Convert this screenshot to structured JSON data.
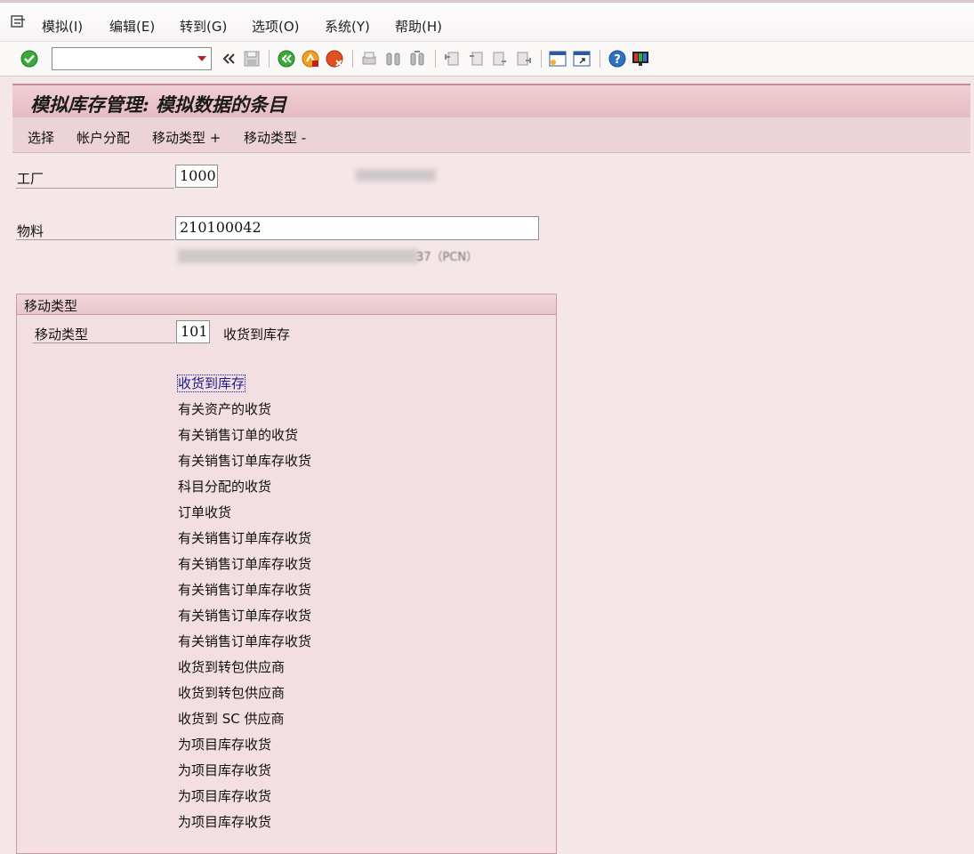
{
  "menubar": {
    "items": [
      "模拟(I)",
      "编辑(E)",
      "转到(G)",
      "选项(O)",
      "系统(Y)",
      "帮助(H)"
    ]
  },
  "toolbar": {
    "command_field_value": "",
    "icons": [
      "enter-icon",
      "back-nav-icon",
      "save-icon",
      "back-icon",
      "exit-icon",
      "cancel-icon",
      "print-icon",
      "find-icon",
      "find-next-icon",
      "first-page-icon",
      "prev-page-icon",
      "next-page-icon",
      "last-page-icon",
      "new-session-icon",
      "shortcut-icon",
      "help-icon",
      "customize-layout-icon"
    ]
  },
  "title": "模拟库存管理: 模拟数据的条目",
  "appbar": {
    "buttons": [
      "选择",
      "帐户分配",
      "移动类型 +",
      "移动类型 -"
    ]
  },
  "form": {
    "plant_label": "工厂",
    "plant_value": "1000",
    "material_label": "物料",
    "material_value": "210100042",
    "material_desc_suffix": "37（PCN）"
  },
  "movement_group": {
    "title": "移动类型",
    "type_label": "移动类型",
    "type_value": "101",
    "type_desc": "收货到库存",
    "options": [
      "收货到库存",
      "有关资产的收货",
      "有关销售订单的收货",
      "有关销售订单库存收货",
      "科目分配的收货",
      "订单收货",
      "有关销售订单库存收货",
      "有关销售订单库存收货",
      "有关销售订单库存收货",
      "有关销售订单库存收货",
      "有关销售订单库存收货",
      "收货到转包供应商",
      "收货到转包供应商",
      "收货到 SC 供应商",
      "为项目库存收货",
      "为项目库存收货",
      "为项目库存收货",
      "为项目库存收货"
    ]
  },
  "colors": {
    "background": "#f5e6e8",
    "title_bar": "#e6bcc3",
    "accent_green": "#3aa83a",
    "accent_orange": "#f0a020",
    "accent_red": "#d04020"
  }
}
